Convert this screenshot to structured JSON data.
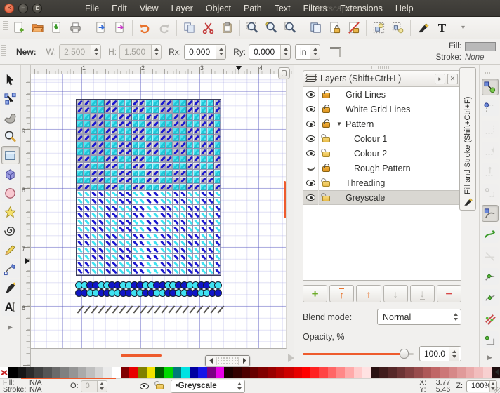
{
  "window": {
    "ghost_title": "Inkscape",
    "buttons": [
      "close",
      "minimize",
      "maximize"
    ]
  },
  "menu": {
    "items": [
      "File",
      "Edit",
      "View",
      "Layer",
      "Object",
      "Path",
      "Text",
      "Filters",
      "Extensions",
      "Help"
    ]
  },
  "command_bar": {
    "groups": [
      [
        "new-document",
        "open-document",
        "save-document",
        "print-document"
      ],
      [
        "import-image",
        "export-png"
      ],
      [
        "undo",
        "redo"
      ],
      [
        "copy",
        "cut",
        "paste"
      ],
      [
        "zoom-to-selection",
        "zoom-to-drawing",
        "zoom-to-page"
      ],
      [
        "duplicate",
        "create-clone",
        "unlink-clone"
      ],
      [
        "group-objects",
        "ungroup-objects"
      ],
      [
        "fill-stroke-dialog",
        "text-dialog"
      ]
    ]
  },
  "tool_options": {
    "mode_label": "New:",
    "w_label": "W:",
    "w_value": "2.500",
    "h_label": "H:",
    "h_value": "1.500",
    "rx_label": "Rx:",
    "rx_value": "0.000",
    "ry_label": "Ry:",
    "ry_value": "0.000",
    "unit": "in",
    "fill_label": "Fill:",
    "stroke_label": "Stroke:",
    "stroke_value": "None"
  },
  "toolbox": {
    "tools": [
      "selector-tool",
      "node-tool",
      "tweak-tool",
      "zoom-tool",
      "rectangle-tool",
      "box-3d-tool",
      "ellipse-tool",
      "star-tool",
      "spiral-tool",
      "pencil-tool",
      "bezier-tool",
      "calligraphy-tool",
      "text-tool"
    ],
    "selected": "rectangle-tool"
  },
  "rulers": {
    "horizontal_numbers": [
      "1",
      "2",
      "3",
      "4"
    ],
    "vertical_numbers": [
      "9",
      "8",
      "7",
      "6"
    ]
  },
  "canvas": {
    "chart": {
      "cols": 21,
      "rows_top": [
        "BBCCBBCCBBCCBBCCBBCCB",
        "BBCCBBCCBBCCBBCCBBCCB",
        "CCBBCCBBCCBBCCBBCCBBC",
        "CCBBCCBBCCBBCCBBCCBBC",
        "BBCCBBCCBBCCBBCCBBCCB",
        "BBCCBBCCBBCCBBCCBBCCB",
        "CCBBCCBBCCBBCCBBCCBBC",
        "CCBBCCBBCCBBCCBBCCBBC",
        "BBCCBBCCBBCCBBCCBBCCB",
        "BBCCBBCCBBCCBBCCBBCCB",
        "CCBBCCBBCCBBCCBBCCBBC",
        "CCBBCCBBCCBBCCBBCCBBC",
        "BBCCBBCCBBCCBBCCBBCCB"
      ],
      "rows_bottom": [
        "CCBBCCBBCCBBCCBBCCBBC",
        "CCBBCCBBCCBBCCBBCCBBC",
        "BBCCBBCCBBCCBBCCBBCCB",
        "BBCCBBCCBBCCBBCCBBCCB",
        "CCBBCCBBCCBBCCBBCCBBC",
        "CCBBCCBBCCBBCCBBCCBBC",
        "BBCCBBCCBBCCBBCCBBCCB",
        "BBCCBBCCBBCCBBCCBBCCB",
        "CCBBCCBBCCBBCCBBCCBBC",
        "CCBBCCBBCCBBCCBBCCBBC",
        "BBCCBBCCBBCCBBCCBBCCB",
        "BBCCBBCCBBCCBBCCBBCCB"
      ],
      "blue": "#1a18d0",
      "cyan": "#3fe2f2",
      "top_cell_gray": "#c9c9c9"
    },
    "threading": {
      "rows": [
        "CCBBCCBBCCBBCCBBCCBBCCBBCC",
        "BBCCBBCCBBCCBBCCBBCCBBCCBB"
      ],
      "blue": "#1016c8",
      "cyan": "#3fe2f2"
    },
    "tail_slashes": 21
  },
  "layers_panel": {
    "title": "Layers (Shift+Ctrl+L)",
    "rows": [
      {
        "label": "Grid Lines",
        "visible": true,
        "locked": true,
        "indent": 0,
        "expander": false,
        "selected": false
      },
      {
        "label": "White Grid Lines",
        "visible": true,
        "locked": true,
        "indent": 0,
        "expander": false,
        "selected": false
      },
      {
        "label": "Pattern",
        "visible": true,
        "locked": true,
        "indent": 0,
        "expander": true,
        "selected": false
      },
      {
        "label": "Colour 1",
        "visible": true,
        "locked": false,
        "indent": 1,
        "expander": false,
        "selected": false
      },
      {
        "label": "Colour 2",
        "visible": true,
        "locked": false,
        "indent": 1,
        "expander": false,
        "selected": false
      },
      {
        "label": "Rough Pattern",
        "visible": false,
        "locked": true,
        "indent": 1,
        "expander": false,
        "selected": false
      },
      {
        "label": "Threading",
        "visible": true,
        "locked": false,
        "indent": 0,
        "expander": false,
        "selected": false
      },
      {
        "label": "Greyscale",
        "visible": true,
        "locked": false,
        "indent": 0,
        "expander": false,
        "selected": true
      }
    ],
    "buttons": [
      "add-layer",
      "raise-layer-to-top",
      "raise-layer",
      "lower-layer",
      "lower-layer-to-bottom",
      "delete-layer"
    ],
    "blend_mode_label": "Blend mode:",
    "blend_mode_value": "Normal",
    "opacity_label": "Opacity, %",
    "opacity_value": "100.0",
    "opacity_percent": 100
  },
  "fill_stroke_tab": {
    "label": "Fill and Stroke (Shift+Ctrl+F)"
  },
  "snap_bar": {
    "items": [
      {
        "name": "enable-snapping",
        "state": "pressed"
      },
      {
        "name": "snap-bounding-box",
        "state": "normal"
      },
      {
        "name": "snap-bbox-edges",
        "state": "disabled"
      },
      {
        "name": "snap-bbox-corners",
        "state": "disabled"
      },
      {
        "name": "snap-bbox-edge-midpoints",
        "state": "disabled"
      },
      {
        "name": "snap-bbox-centers",
        "state": "disabled"
      },
      {
        "name": "snap-nodes",
        "state": "pressed"
      },
      {
        "name": "snap-to-paths",
        "state": "normal"
      },
      {
        "name": "snap-path-intersections",
        "state": "disabled"
      },
      {
        "name": "snap-cusp-nodes",
        "state": "normal"
      },
      {
        "name": "snap-smooth-nodes",
        "state": "normal"
      },
      {
        "name": "snap-line-midpoints",
        "state": "normal"
      },
      {
        "name": "snap-object-centers",
        "state": "normal"
      }
    ]
  },
  "palette": {
    "swatches": [
      "none",
      "#000000",
      "#161616",
      "#2b2b2b",
      "#404040",
      "#555555",
      "#6a6a6a",
      "#808080",
      "#959595",
      "#aaaaaa",
      "#bfbfbf",
      "#d4d4d4",
      "#eaeaea",
      "#ffffff",
      "#800000",
      "#e80000",
      "#808000",
      "#f2e200",
      "#005a00",
      "#00d800",
      "#007a7a",
      "#00e2e2",
      "#0000a0",
      "#1414e8",
      "#7a0082",
      "#e800e8",
      "#1c0000",
      "#330000",
      "#4d0000",
      "#660000",
      "#800000",
      "#990000",
      "#b30000",
      "#cc0000",
      "#e60000",
      "#ff0000",
      "#ff2222",
      "#ff4444",
      "#ff6666",
      "#ff8888",
      "#ffaaaa",
      "#ffcccc",
      "#ffe2e2",
      "#2a1212",
      "#401c1c",
      "#562828",
      "#6c3434",
      "#824040",
      "#984c4c",
      "#ae5858",
      "#c06666",
      "#cc7777",
      "#d68888",
      "#e09999",
      "#eaabab",
      "#f2bdbd",
      "#f8d0d0",
      "#1e0e0e"
    ]
  },
  "status_bar": {
    "fill_label": "Fill:",
    "fill_value": "N/A",
    "stroke_label": "Stroke:",
    "stroke_value": "N/A",
    "opacity_label": "O:",
    "opacity_value": "0",
    "layer_value": "•Greyscale",
    "x_label": "X:",
    "x_value": "3.77",
    "y_label": "Y:",
    "y_value": "5.46",
    "zoom_label": "Z:",
    "zoom_value": "100%"
  }
}
